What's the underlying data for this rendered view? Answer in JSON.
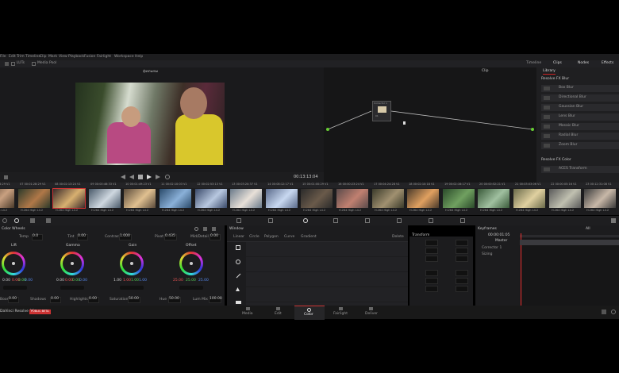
{
  "menu": [
    "File",
    "Edit",
    "Trim",
    "Timeline",
    "Clip",
    "Mark",
    "View",
    "Playback",
    "Fusion",
    "Fairlight",
    "Workspace",
    "Help"
  ],
  "toolbar": {
    "luts": "LUTs",
    "media_pool": "Media Pool",
    "timeline": "Timeline",
    "clips": "Clips",
    "nodes": "Nodes",
    "effects": "Effects"
  },
  "viewer": {
    "title": "фильмы",
    "timecode": "00:13:13:04"
  },
  "node_editor": {
    "title": "Clip",
    "node_label": "Corrector 1",
    "node_num": "01"
  },
  "library": {
    "tab": "Library",
    "blur_header": "Resolve FX Blur",
    "blur_items": [
      "Box Blur",
      "Directional Blur",
      "Gaussian Blur",
      "Lens Blur",
      "Mosaic Blur",
      "Radial Blur",
      "Zoom Blur"
    ],
    "color_header": "Resolve FX Color",
    "color_items": [
      "ACES Transform"
    ]
  },
  "clips": [
    {
      "num": "06",
      "tc": "00:01:28:29",
      "codec": "H.264 High L4.2"
    },
    {
      "num": "07",
      "tc": "00:01:28:29",
      "codec": "H.264 High L4.2"
    },
    {
      "num": "08",
      "tc": "00:02:13:24",
      "codec": "H.264 High L4.2"
    },
    {
      "num": "09",
      "tc": "00:00:46:33",
      "codec": "H.264 High L4.2"
    },
    {
      "num": "10",
      "tc": "00:01:49:23",
      "codec": "H.264 High L4.2"
    },
    {
      "num": "11",
      "tc": "00:02:10:03",
      "codec": "H.264 High L4.2"
    },
    {
      "num": "12",
      "tc": "00:02:53:13",
      "codec": "H.264 High L4.2"
    },
    {
      "num": "13",
      "tc": "00:03:20:37",
      "codec": "H.264 High L4.2"
    },
    {
      "num": "14",
      "tc": "00:08:12:17",
      "codec": "H.264 High L4.2"
    },
    {
      "num": "15",
      "tc": "00:01:00:29",
      "codec": "H.264 High L4.2"
    },
    {
      "num": "16",
      "tc": "00:00:23:24",
      "codec": "H.264 High L4.2"
    },
    {
      "num": "17",
      "tc": "00:04:24:28",
      "codec": "H.264 High L4.2"
    },
    {
      "num": "18",
      "tc": "00:02:10:18",
      "codec": "H.264 High L4.2"
    },
    {
      "num": "19",
      "tc": "00:02:16:17",
      "codec": "H.264 High L4.2"
    },
    {
      "num": "20",
      "tc": "00:00:52:21",
      "codec": "H.264 High L4.2"
    },
    {
      "num": "21",
      "tc": "00:03:03:06",
      "codec": "H.264 High L4.2"
    },
    {
      "num": "22",
      "tc": "00:00:05:16",
      "codec": "H.264 High L4.2"
    },
    {
      "num": "23",
      "tc": "00:12:31:08",
      "codec": "H.264 High L4.2"
    }
  ],
  "color_wheels": {
    "title": "Color Wheels",
    "temp_label": "Temp",
    "temp": "0.0",
    "tint_label": "Tint",
    "tint": "0.00",
    "contrast_label": "Contrast",
    "contrast": "1.000",
    "pivot_label": "Pivot",
    "pivot": "0.435",
    "middetail_label": "Mid/Detail",
    "middetail": "0.00",
    "wheels": [
      {
        "name": "Lift",
        "values": [
          "0.00",
          "0.00",
          "0.00",
          "0.00"
        ]
      },
      {
        "name": "Gamma",
        "values": [
          "0.00",
          "0.00",
          "0.00",
          "0.00"
        ]
      },
      {
        "name": "Gain",
        "values": [
          "1.00",
          "1.00",
          "1.00",
          "1.00"
        ]
      },
      {
        "name": "Offset",
        "values": [
          "25.00",
          "25.00",
          "25.00"
        ]
      }
    ],
    "boost_label": "Boost",
    "boost": "0.00",
    "shadows_label": "Shadows",
    "shadows": "0.00",
    "highlights_label": "Highlights",
    "highlights": "0.00",
    "saturation_label": "Saturation",
    "saturation": "50.00",
    "hue_label": "Hue",
    "hue": "50.00",
    "lummix_label": "Lum Mix",
    "lummix": "100.00"
  },
  "window": {
    "title": "Window",
    "modes": [
      "Linear",
      "Circle",
      "Polygon",
      "Curve",
      "Gradient"
    ],
    "delete": "Delete",
    "transform": "Transform",
    "softness": "Softness"
  },
  "keyframes": {
    "title": "Keyframes",
    "filter": "All",
    "master": "Master",
    "tc": "00:00:01:05",
    "tracks": [
      "Corrector 1",
      "Sizing"
    ]
  },
  "pages": [
    {
      "label": "Media",
      "active": false
    },
    {
      "label": "Edit",
      "active": false
    },
    {
      "label": "Color",
      "active": true
    },
    {
      "label": "Fairlight",
      "active": false
    },
    {
      "label": "Deliver",
      "active": false
    }
  ],
  "app": {
    "name": "DaVinci Resolve 16",
    "badge": "PUBLIC BETA"
  }
}
